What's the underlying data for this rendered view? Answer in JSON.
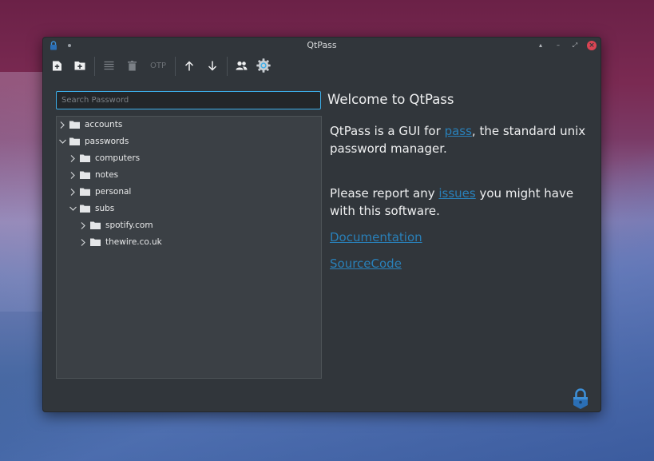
{
  "window": {
    "title": "QtPass"
  },
  "toolbar": {
    "otp_label": "OTP",
    "icons": [
      "add-password-icon",
      "add-folder-icon",
      "edit-icon",
      "delete-icon",
      "otp-icon",
      "push-icon",
      "pull-icon",
      "users-icon",
      "config-icon"
    ]
  },
  "search": {
    "placeholder": "Search Password"
  },
  "tree": {
    "items": [
      {
        "label": "accounts",
        "expanded": false
      },
      {
        "label": "passwords",
        "expanded": true
      },
      {
        "label": "computers",
        "expanded": false
      },
      {
        "label": "notes",
        "expanded": false
      },
      {
        "label": "personal",
        "expanded": false
      },
      {
        "label": "subs",
        "expanded": true
      },
      {
        "label": "spotify.com",
        "expanded": false
      },
      {
        "label": "thewire.co.uk",
        "expanded": false
      }
    ]
  },
  "info": {
    "welcome": "Welcome to QtPass",
    "intro_prefix": "QtPass is a GUI for ",
    "intro_link": "pass",
    "intro_suffix": ", the standard unix password manager.",
    "report_prefix": "Please report any ",
    "report_link": "issues",
    "report_suffix": " you might have with this software.",
    "documentation_link": "Documentation",
    "sourcecode_link": "SourceCode"
  },
  "colors": {
    "accent": "#3daee9",
    "link": "#2980b9",
    "window_bg": "#31363b",
    "close_button": "#da4453"
  }
}
